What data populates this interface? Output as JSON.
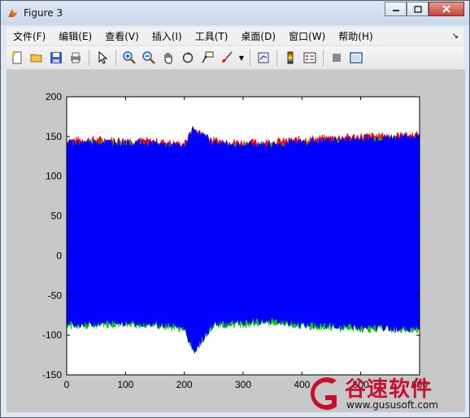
{
  "window": {
    "title": "Figure 3"
  },
  "menu": [
    "文件(F)",
    "编辑(E)",
    "查看(V)",
    "插入(I)",
    "工具(T)",
    "桌面(D)",
    "窗口(W)",
    "帮助(H)"
  ],
  "toolbar": {
    "icons": [
      "new-figure-icon",
      "open-icon",
      "save-icon",
      "print-icon",
      "pointer-icon",
      "zoom-in-icon",
      "zoom-out-icon",
      "pan-icon",
      "rotate-icon",
      "data-cursor-icon",
      "brush-icon",
      "link-icon",
      "colorbar-icon",
      "legend-icon",
      "hide-tools-icon",
      "show-tools-icon"
    ]
  },
  "watermark": {
    "text": "谷速软件",
    "url": "www.gususoft.com"
  },
  "colors": {
    "series1": "#ff0000",
    "series2": "#00cc00",
    "series3": "#0000ff",
    "figure_bg": "#c8c8c8"
  },
  "chart_data": {
    "type": "line",
    "title": "",
    "xlabel": "",
    "ylabel": "",
    "xlim": [
      0,
      600
    ],
    "ylim": [
      -150,
      200
    ],
    "xticks": [
      0,
      100,
      200,
      300,
      400,
      500,
      600
    ],
    "xtick_labels": [
      "0",
      "100",
      "200",
      "300",
      "400",
      "500",
      "600"
    ],
    "yticks": [
      200,
      150,
      100,
      50,
      0,
      -50,
      -100,
      -150
    ],
    "ytick_labels": [
      "200",
      "150",
      "100",
      "50",
      "0",
      "-50",
      "-100",
      "-150"
    ],
    "grid": false,
    "series": [
      {
        "color": "#ff0000",
        "envelope_x": [
          0,
          50,
          100,
          150,
          200,
          215,
          250,
          300,
          350,
          400,
          450,
          500,
          600
        ],
        "upper": [
          145,
          146,
          145,
          144,
          140,
          158,
          145,
          142,
          143,
          146,
          148,
          150,
          152
        ],
        "lower": [
          -82,
          -81,
          -80,
          -80,
          -84,
          -100,
          -80,
          -79,
          -78,
          -80,
          -82,
          -84,
          -85
        ]
      },
      {
        "color": "#00cc00",
        "envelope_x": [
          0,
          50,
          100,
          150,
          200,
          215,
          250,
          300,
          350,
          400,
          450,
          500,
          600
        ],
        "upper": [
          140,
          141,
          140,
          139,
          135,
          150,
          140,
          137,
          138,
          141,
          143,
          145,
          147
        ],
        "lower": [
          -88,
          -87,
          -86,
          -87,
          -92,
          -120,
          -87,
          -86,
          -84,
          -88,
          -90,
          -92,
          -93
        ]
      },
      {
        "color": "#0000ff",
        "envelope_x": [
          0,
          50,
          100,
          150,
          200,
          215,
          250,
          300,
          350,
          400,
          450,
          500,
          600
        ],
        "upper": [
          142,
          143,
          142,
          141,
          137,
          160,
          142,
          139,
          140,
          143,
          145,
          147,
          150
        ],
        "lower": [
          -86,
          -85,
          -84,
          -85,
          -90,
          -122,
          -85,
          -84,
          -82,
          -86,
          -88,
          -90,
          -92
        ]
      }
    ]
  }
}
